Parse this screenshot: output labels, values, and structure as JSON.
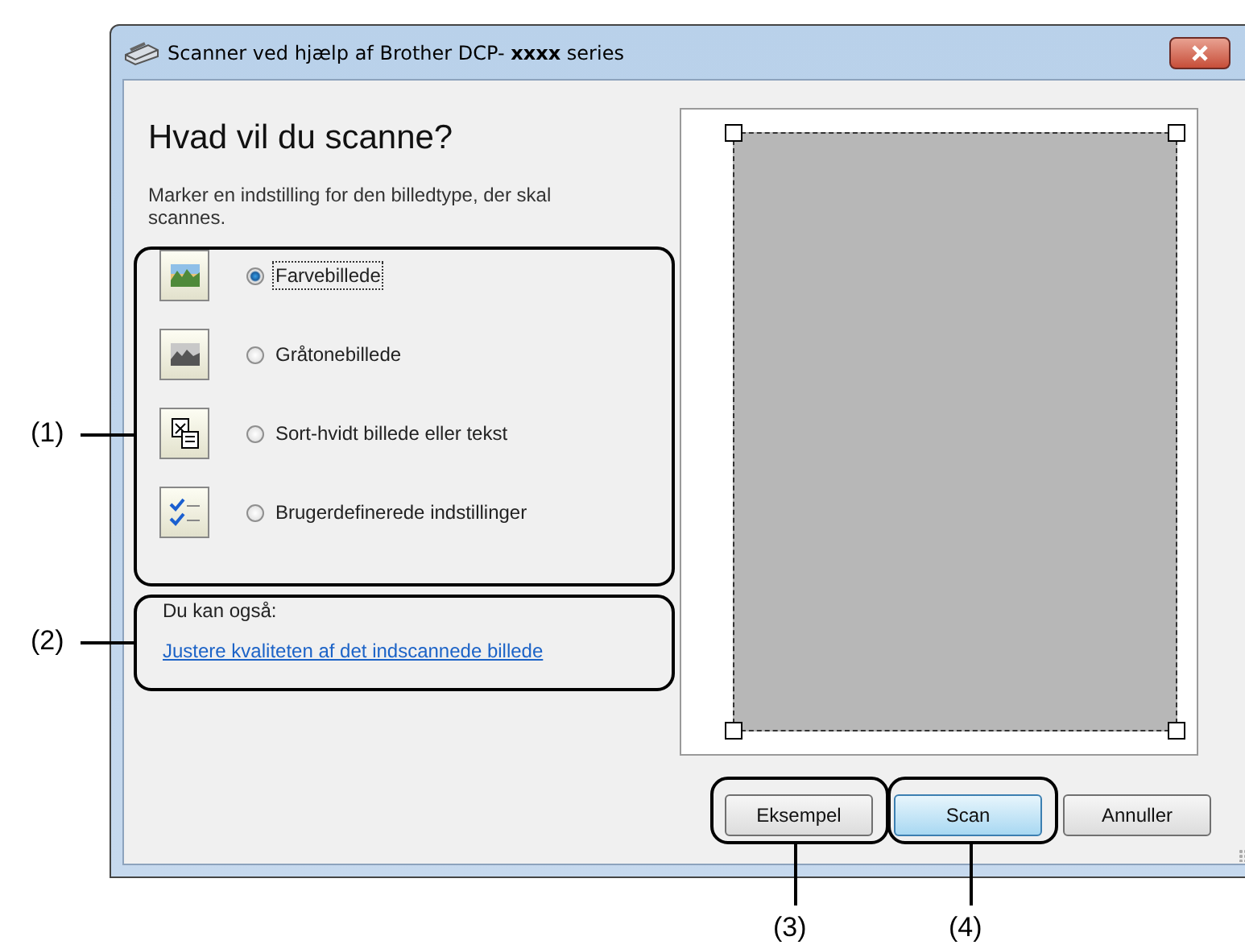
{
  "window": {
    "title": "Scanner ved hjælp af Brother DCP- **xxxx** series"
  },
  "heading": "Hvad vil du scanne?",
  "instruction": "Marker en indstilling for den billedtype, der skal scannes.",
  "options": [
    {
      "kind": "color-photo",
      "label": "Farvebillede",
      "selected": true
    },
    {
      "kind": "grayscale-photo",
      "label": "Gråtonebillede",
      "selected": false
    },
    {
      "kind": "text",
      "label": "Sort-hvidt billede eller tekst",
      "selected": false
    },
    {
      "kind": "custom",
      "label": "Brugerdefinerede indstillinger",
      "selected": false
    }
  ],
  "also": {
    "label": "Du kan også:",
    "link": "Justere kvaliteten af det indscannede billede"
  },
  "buttons": [
    {
      "label": "Eksempel",
      "default": false
    },
    {
      "label": "Scan",
      "default": true
    },
    {
      "label": "Annuller",
      "default": false
    }
  ],
  "callouts": [
    "(1)",
    "(2)",
    "(3)",
    "(4)"
  ]
}
